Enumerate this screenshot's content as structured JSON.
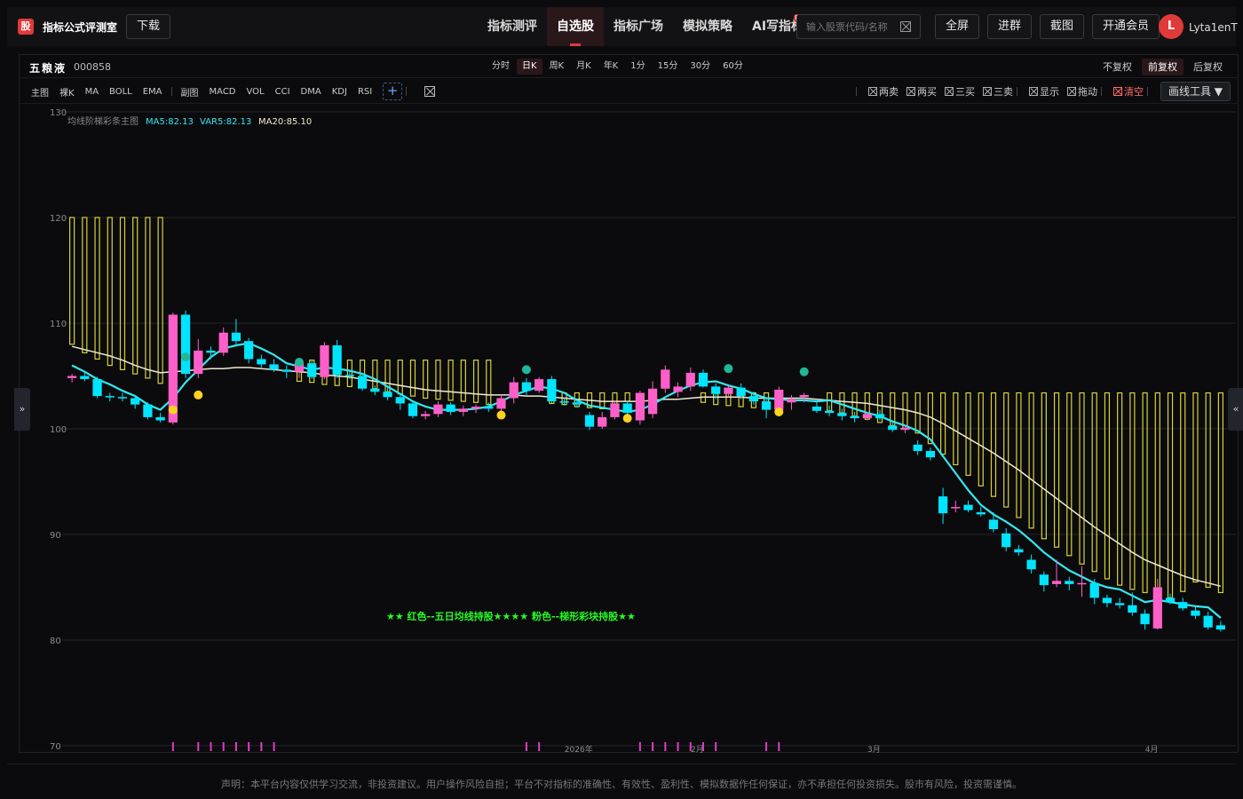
{
  "app": {
    "logo_char": "股",
    "title": "指标公式评测室",
    "download_label": "下载"
  },
  "nav": {
    "items": [
      {
        "label": "指标测评",
        "active": false
      },
      {
        "label": "自选股",
        "active": true
      },
      {
        "label": "指标广场",
        "active": false
      },
      {
        "label": "模拟策略",
        "active": false
      },
      {
        "label": "AI写指标",
        "active": false,
        "badge": "NEW"
      }
    ]
  },
  "search": {
    "placeholder": "输入股票代码/名称"
  },
  "top_buttons": [
    "全屏",
    "进群",
    "截图",
    "开通会员"
  ],
  "user": {
    "initial": "L",
    "name": "Lyta1enT"
  },
  "stock": {
    "name": "五粮液",
    "code": "000858"
  },
  "periods": [
    {
      "label": "分时",
      "active": false
    },
    {
      "label": "日K",
      "active": true
    },
    {
      "label": "周K",
      "active": false
    },
    {
      "label": "月K",
      "active": false
    },
    {
      "label": "年K",
      "active": false
    },
    {
      "label": "1分",
      "active": false
    },
    {
      "label": "15分",
      "active": false
    },
    {
      "label": "30分",
      "active": false
    },
    {
      "label": "60分",
      "active": false
    }
  ],
  "adjust": [
    {
      "label": "不复权",
      "active": false
    },
    {
      "label": "前复权",
      "active": true
    },
    {
      "label": "后复权",
      "active": false
    }
  ],
  "indicators_main": [
    "主图",
    "裸K",
    "MA",
    "BOLL",
    "EMA"
  ],
  "indicators_sub": [
    "副图",
    "MACD",
    "VOL",
    "CCI",
    "DMA",
    "KDJ",
    "RSI"
  ],
  "signals": [
    {
      "label": "两卖",
      "red": false
    },
    {
      "label": "两买",
      "red": false
    },
    {
      "label": "三买",
      "red": false
    },
    {
      "label": "三卖",
      "red": false
    },
    {
      "label": "显示",
      "red": false
    },
    {
      "label": "拖动",
      "red": false
    },
    {
      "label": "清空",
      "red": true
    }
  ],
  "draw_tool_label": "画线工具 ▼",
  "legend": {
    "name": "均线阶梯彩条主图",
    "ma5": "MA5:82.13",
    "var5": "VAR5:82.13",
    "ma20": "MA20:85.10"
  },
  "annotation": "★★ 红色--五日均线持股★★★★ 粉色--梯形彩块持股★★",
  "colors": {
    "up": "#ff5fc8",
    "down": "#00e5ff",
    "accent": "#e03a3a",
    "step": "#d8d23a",
    "ma20": "#f0ead0",
    "ma5": "#33e8f0"
  },
  "chart_data": {
    "type": "candlestick",
    "ylim": [
      70,
      130
    ],
    "yticks": [
      70,
      80,
      90,
      100,
      110,
      120,
      130
    ],
    "xlabels": [
      {
        "label": "2026年",
        "index": 40
      },
      {
        "label": "2月",
        "index": 50
      },
      {
        "label": "3月",
        "index": 64
      },
      {
        "label": "4月",
        "index": 86
      }
    ],
    "candles": [
      [
        104.8,
        105.2,
        104.4,
        105.0
      ],
      [
        105.0,
        105.4,
        104.5,
        104.7
      ],
      [
        104.7,
        104.9,
        102.9,
        103.1
      ],
      [
        103.1,
        103.4,
        102.6,
        103.0
      ],
      [
        103.0,
        103.4,
        102.6,
        102.9
      ],
      [
        102.9,
        103.2,
        101.9,
        102.3
      ],
      [
        102.3,
        102.5,
        100.9,
        101.1
      ],
      [
        101.1,
        101.5,
        100.6,
        100.8
      ],
      [
        100.6,
        111.0,
        100.4,
        110.8
      ],
      [
        110.8,
        111.2,
        104.8,
        105.2
      ],
      [
        105.2,
        108.5,
        104.8,
        107.4
      ],
      [
        107.4,
        107.8,
        106.6,
        107.2
      ],
      [
        107.2,
        109.6,
        106.9,
        109.1
      ],
      [
        109.1,
        110.4,
        108.0,
        108.3
      ],
      [
        108.3,
        108.6,
        106.2,
        106.6
      ],
      [
        106.6,
        107.0,
        105.8,
        106.1
      ],
      [
        106.1,
        106.6,
        105.4,
        105.6
      ],
      [
        105.6,
        106.0,
        104.8,
        105.4
      ],
      [
        105.4,
        106.7,
        104.8,
        106.2
      ],
      [
        106.2,
        106.5,
        104.7,
        104.9
      ],
      [
        104.9,
        108.2,
        104.7,
        107.9
      ],
      [
        107.9,
        108.4,
        104.8,
        105.1
      ],
      [
        105.1,
        105.5,
        104.7,
        105.0
      ],
      [
        105.0,
        105.3,
        103.6,
        103.8
      ],
      [
        103.8,
        104.1,
        103.2,
        103.5
      ],
      [
        103.5,
        103.9,
        102.7,
        103.0
      ],
      [
        103.0,
        103.4,
        101.8,
        102.4
      ],
      [
        102.4,
        102.6,
        101.0,
        101.2
      ],
      [
        101.2,
        101.7,
        100.9,
        101.4
      ],
      [
        101.4,
        102.6,
        101.1,
        102.3
      ],
      [
        102.3,
        102.5,
        101.3,
        101.6
      ],
      [
        101.6,
        102.2,
        101.2,
        101.9
      ],
      [
        101.9,
        102.3,
        101.5,
        102.1
      ],
      [
        102.1,
        102.5,
        101.6,
        101.9
      ],
      [
        101.9,
        103.2,
        101.6,
        102.9
      ],
      [
        102.9,
        104.9,
        102.4,
        104.4
      ],
      [
        104.4,
        104.8,
        103.1,
        103.6
      ],
      [
        103.6,
        104.9,
        103.4,
        104.7
      ],
      [
        104.7,
        105.0,
        102.4,
        102.6
      ],
      [
        102.6,
        103.0,
        102.2,
        102.5
      ],
      [
        102.5,
        102.8,
        102.0,
        102.3
      ],
      [
        101.3,
        101.6,
        99.9,
        100.2
      ],
      [
        100.2,
        101.6,
        100.0,
        101.1
      ],
      [
        101.1,
        102.7,
        100.9,
        102.4
      ],
      [
        102.4,
        102.6,
        101.2,
        101.5
      ],
      [
        100.8,
        103.6,
        100.4,
        103.4
      ],
      [
        101.4,
        104.5,
        101.0,
        103.8
      ],
      [
        103.8,
        106.0,
        103.4,
        105.6
      ],
      [
        103.5,
        104.4,
        103.0,
        104.0
      ],
      [
        104.0,
        105.8,
        103.6,
        105.3
      ],
      [
        105.3,
        105.6,
        103.9,
        104.0
      ],
      [
        104.0,
        104.3,
        102.8,
        103.3
      ],
      [
        103.3,
        104.1,
        103.0,
        103.9
      ],
      [
        103.9,
        104.3,
        102.8,
        103.1
      ],
      [
        103.1,
        103.5,
        102.3,
        102.6
      ],
      [
        102.6,
        102.9,
        101.0,
        101.8
      ],
      [
        101.8,
        104.0,
        101.6,
        103.7
      ],
      [
        102.5,
        103.2,
        101.8,
        102.8
      ],
      [
        103.0,
        103.4,
        102.5,
        103.2
      ],
      [
        102.1,
        102.5,
        101.5,
        101.7
      ],
      [
        101.7,
        102.2,
        101.2,
        101.5
      ],
      [
        101.5,
        101.9,
        100.8,
        101.2
      ],
      [
        101.2,
        101.6,
        100.6,
        101.0
      ],
      [
        101.0,
        101.6,
        100.8,
        101.4
      ],
      [
        101.4,
        101.8,
        100.8,
        101.0
      ],
      [
        100.3,
        100.7,
        99.7,
        99.9
      ],
      [
        99.9,
        100.3,
        99.6,
        100.1
      ],
      [
        98.5,
        98.9,
        97.5,
        97.9
      ],
      [
        97.9,
        98.2,
        97.0,
        97.3
      ],
      [
        93.6,
        94.4,
        91.0,
        92.0
      ],
      [
        92.5,
        93.2,
        92.1,
        92.6
      ],
      [
        92.8,
        93.2,
        92.1,
        92.3
      ],
      [
        92.1,
        92.6,
        91.7,
        91.9
      ],
      [
        91.4,
        92.1,
        90.2,
        90.5
      ],
      [
        90.1,
        90.6,
        88.4,
        88.8
      ],
      [
        88.6,
        89.0,
        88.0,
        88.3
      ],
      [
        87.6,
        88.1,
        86.3,
        86.7
      ],
      [
        86.2,
        86.5,
        84.6,
        85.2
      ],
      [
        85.3,
        87.6,
        85.0,
        85.6
      ],
      [
        85.6,
        86.0,
        84.7,
        85.3
      ],
      [
        85.3,
        87.0,
        84.1,
        85.4
      ],
      [
        85.4,
        85.8,
        83.4,
        84.0
      ],
      [
        84.0,
        84.3,
        83.1,
        83.5
      ],
      [
        83.5,
        84.0,
        83.0,
        83.3
      ],
      [
        83.3,
        84.5,
        82.3,
        82.6
      ],
      [
        82.5,
        82.9,
        81.0,
        81.5
      ],
      [
        81.1,
        85.8,
        81.0,
        85.0
      ],
      [
        84.0,
        84.4,
        83.4,
        83.6
      ],
      [
        83.6,
        84.0,
        82.8,
        83.0
      ],
      [
        82.8,
        83.2,
        82.0,
        82.3
      ],
      [
        82.3,
        82.7,
        81.0,
        81.2
      ],
      [
        81.4,
        81.8,
        80.8,
        81.0
      ]
    ],
    "series_ma5": [
      106.0,
      105.4,
      104.7,
      104.2,
      103.6,
      103.1,
      102.3,
      101.8,
      102.9,
      104.4,
      105.6,
      106.8,
      107.6,
      107.9,
      108.1,
      107.6,
      107.0,
      106.2,
      105.9,
      105.6,
      105.8,
      105.7,
      105.5,
      105.2,
      104.7,
      104.0,
      103.3,
      102.6,
      102.1,
      101.8,
      101.8,
      101.8,
      101.9,
      102.1,
      102.6,
      103.2,
      103.6,
      104.0,
      103.8,
      103.4,
      102.7,
      102.2,
      102.0,
      101.8,
      101.6,
      101.8,
      102.3,
      103.0,
      103.6,
      104.1,
      104.4,
      104.5,
      104.1,
      103.8,
      103.3,
      102.9,
      102.8,
      102.7,
      102.7,
      102.6,
      102.7,
      102.3,
      101.9,
      101.5,
      101.2,
      100.7,
      100.3,
      99.8,
      99.0,
      97.4,
      95.8,
      94.2,
      92.8,
      91.9,
      91.2,
      90.4,
      89.4,
      88.3,
      87.4,
      86.6,
      86.0,
      85.4,
      85.0,
      84.8,
      84.2,
      83.6,
      83.8,
      83.6,
      83.4,
      83.2,
      83.1,
      82.1
    ],
    "series_ma20": [
      107.8,
      107.5,
      107.2,
      106.9,
      106.5,
      106.0,
      105.6,
      105.3,
      105.4,
      105.5,
      105.6,
      105.7,
      105.7,
      105.8,
      105.8,
      105.7,
      105.6,
      105.5,
      105.4,
      105.3,
      105.1,
      105.0,
      104.9,
      104.7,
      104.5,
      104.3,
      104.1,
      103.9,
      103.7,
      103.6,
      103.5,
      103.4,
      103.3,
      103.2,
      103.2,
      103.2,
      103.1,
      103.1,
      103.0,
      102.9,
      102.8,
      102.7,
      102.6,
      102.6,
      102.6,
      102.6,
      102.7,
      102.8,
      102.8,
      102.9,
      103.0,
      103.0,
      103.0,
      103.0,
      102.9,
      102.9,
      102.9,
      102.9,
      102.9,
      102.8,
      102.7,
      102.6,
      102.5,
      102.4,
      102.2,
      102.0,
      101.8,
      101.5,
      101.1,
      100.5,
      99.8,
      99.1,
      98.4,
      97.7,
      96.9,
      96.1,
      95.2,
      94.3,
      93.4,
      92.5,
      91.6,
      90.7,
      89.9,
      89.1,
      88.3,
      87.6,
      87.1,
      86.6,
      86.1,
      85.7,
      85.4,
      85.1
    ],
    "step_bars": [
      [
        120,
        108
      ],
      [
        120,
        107.2
      ],
      [
        120,
        106.6
      ],
      [
        120,
        106
      ],
      [
        120,
        105.6
      ],
      [
        120,
        105.2
      ],
      [
        120,
        104.8
      ],
      [
        120,
        104.3
      ],
      [
        null,
        null
      ],
      [
        null,
        null
      ],
      [
        null,
        null
      ],
      [
        null,
        null
      ],
      [
        null,
        null
      ],
      [
        null,
        null
      ],
      [
        null,
        null
      ],
      [
        null,
        null
      ],
      [
        null,
        null
      ],
      [
        null,
        null
      ],
      [
        106.5,
        104.5
      ],
      [
        106.5,
        104.4
      ],
      [
        106.5,
        104.2
      ],
      [
        106.5,
        104.1
      ],
      [
        106.5,
        104
      ],
      [
        106.5,
        103.9
      ],
      [
        106.5,
        103.8
      ],
      [
        106.5,
        103.5
      ],
      [
        106.5,
        103.3
      ],
      [
        106.5,
        103.1
      ],
      [
        106.5,
        102.9
      ],
      [
        106.5,
        102.8
      ],
      [
        106.5,
        102.7
      ],
      [
        106.5,
        102.6
      ],
      [
        106.5,
        102.5
      ],
      [
        106.5,
        102.3
      ],
      [
        null,
        null
      ],
      [
        null,
        null
      ],
      [
        null,
        null
      ],
      [
        null,
        null
      ],
      [
        103.4,
        102.4
      ],
      [
        103.4,
        102.3
      ],
      [
        103.4,
        102.1
      ],
      [
        103.4,
        102.0
      ],
      [
        103.4,
        101.9
      ],
      [
        103.4,
        101.8
      ],
      [
        103.4,
        102.6
      ],
      [
        null,
        null
      ],
      [
        null,
        null
      ],
      [
        null,
        null
      ],
      [
        null,
        null
      ],
      [
        null,
        null
      ],
      [
        103.4,
        102.5
      ],
      [
        103.4,
        102.3
      ],
      [
        103.4,
        102.2
      ],
      [
        103.4,
        102.1
      ],
      [
        103.4,
        102.0
      ],
      [
        103.4,
        101.9
      ],
      [
        null,
        null
      ],
      [
        null,
        null
      ],
      [
        null,
        null
      ],
      [
        null,
        null
      ],
      [
        103.4,
        101.7
      ],
      [
        103.4,
        101.5
      ],
      [
        103.4,
        101.2
      ],
      [
        103.4,
        100.9
      ],
      [
        103.4,
        100.6
      ],
      [
        103.4,
        100.3
      ],
      [
        103.4,
        100.0
      ],
      [
        103.4,
        99.6
      ],
      [
        103.4,
        98.6
      ],
      [
        103.4,
        97.6
      ],
      [
        103.4,
        96.6
      ],
      [
        103.4,
        95.6
      ],
      [
        103.4,
        94.6
      ],
      [
        103.4,
        93.6
      ],
      [
        103.4,
        92.6
      ],
      [
        103.4,
        91.6
      ],
      [
        103.4,
        90.6
      ],
      [
        103.4,
        89.6
      ],
      [
        103.4,
        88.8
      ],
      [
        103.4,
        88.0
      ],
      [
        103.4,
        87.2
      ],
      [
        103.4,
        86.5
      ],
      [
        103.4,
        85.8
      ],
      [
        103.4,
        85.2
      ],
      [
        103.4,
        84.8
      ],
      [
        103.4,
        84.5
      ],
      [
        103.4,
        84.2
      ],
      [
        103.4,
        84.0
      ],
      [
        103.4,
        84.6
      ],
      [
        103.4,
        85.5
      ],
      [
        103.4,
        85.0
      ],
      [
        103.4,
        84.5
      ]
    ],
    "dots_green": [
      [
        9,
        106.8
      ],
      [
        18,
        106.3
      ],
      [
        36,
        105.6
      ],
      [
        52,
        105.7
      ],
      [
        58,
        105.4
      ]
    ],
    "dots_yellow": [
      [
        8,
        101.8
      ],
      [
        10,
        103.2
      ],
      [
        34,
        101.3
      ],
      [
        44,
        101.0
      ],
      [
        56,
        101.6
      ]
    ],
    "bottom_ticks": [
      8,
      10,
      11,
      12,
      13,
      14,
      15,
      16,
      36,
      37,
      45,
      46,
      47,
      48,
      49,
      50,
      51,
      55,
      56
    ]
  }
}
